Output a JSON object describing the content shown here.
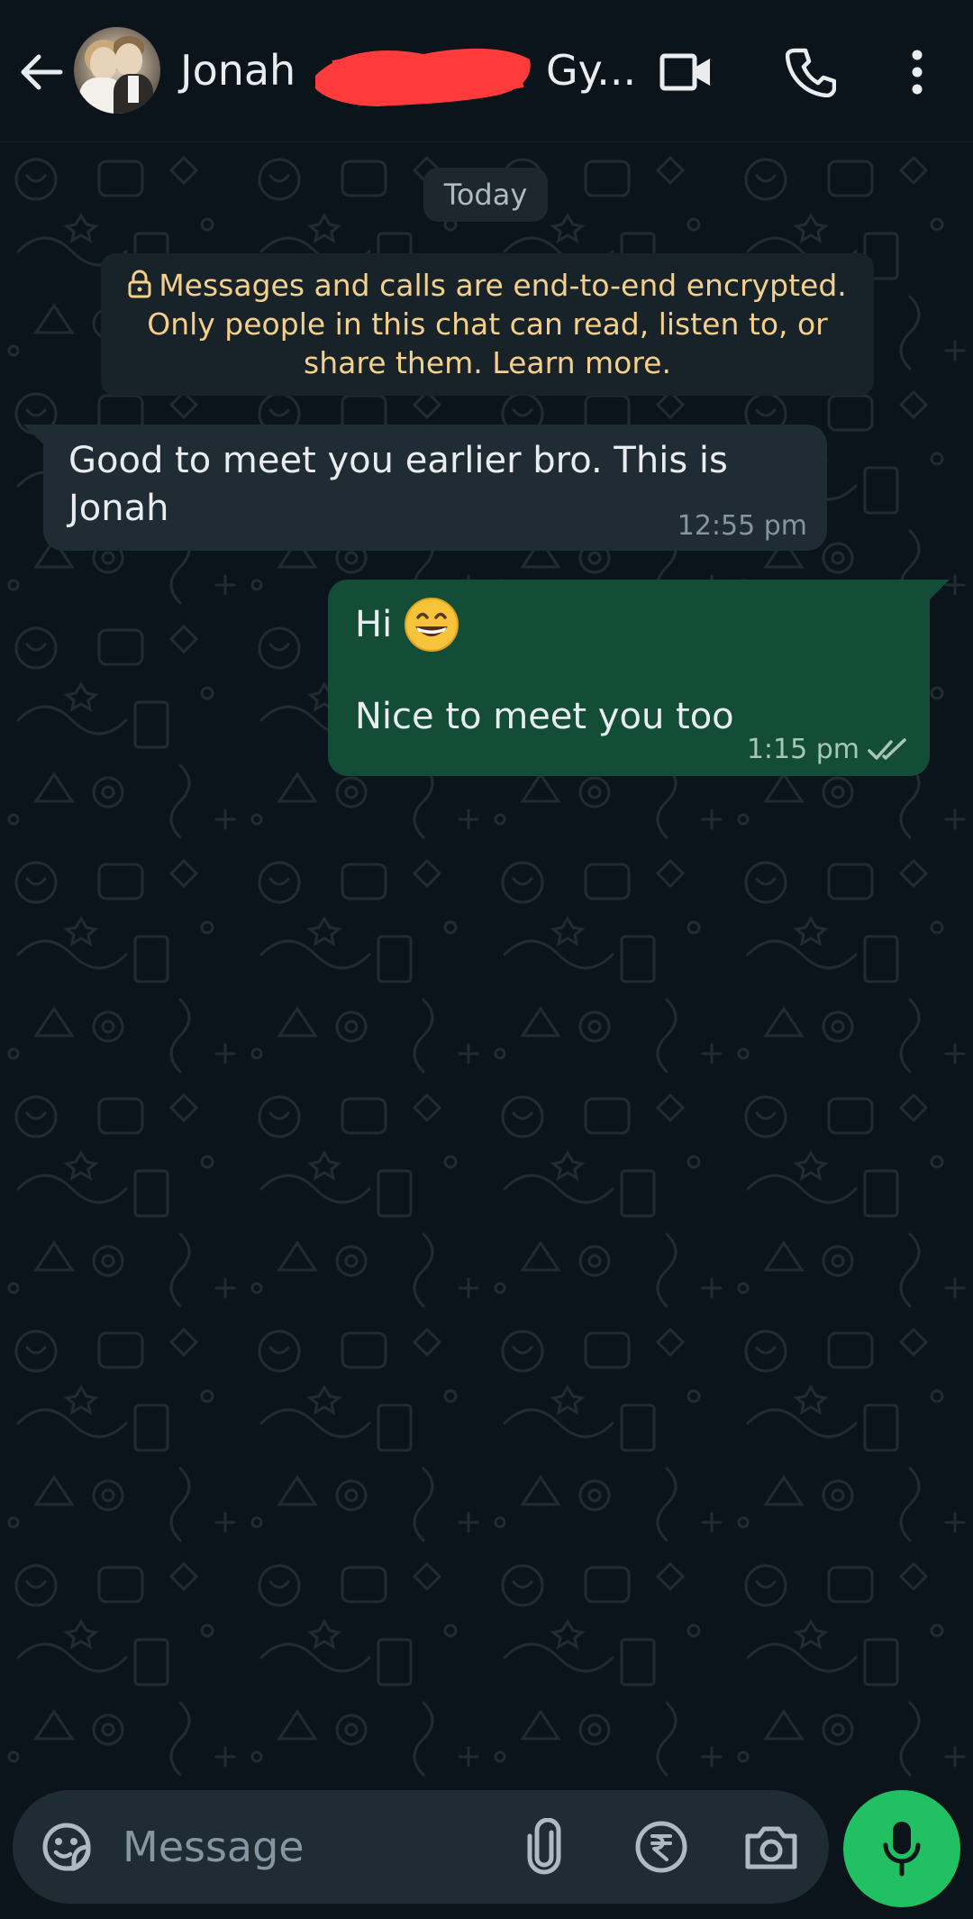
{
  "header": {
    "contact_name_prefix": "Jonah",
    "contact_name_suffix": "Gy...",
    "icons": [
      "back-arrow-icon",
      "video-call-icon",
      "voice-call-icon",
      "more-options-icon"
    ]
  },
  "chat": {
    "date_chip": "Today",
    "encryption_notice": "Messages and calls are end-to-end encrypted. Only people in this chat can read, listen to, or share them. Learn more.",
    "messages": [
      {
        "direction": "incoming",
        "text": "Good to meet you earlier bro. This is Jonah",
        "time": "12:55 pm"
      },
      {
        "direction": "outgoing",
        "line1": "Hi",
        "emoji": "grinning-face-with-smiling-eyes",
        "line2": "Nice to meet you too",
        "time": "1:15 pm",
        "status": "delivered-double-tick"
      }
    ]
  },
  "composer": {
    "placeholder": "Message",
    "icons": [
      "sticker-icon",
      "paperclip-icon",
      "rupee-payment-icon",
      "camera-icon",
      "microphone-icon"
    ]
  },
  "colors": {
    "background": "#0b141a",
    "incoming_bubble": "#1f2c34",
    "outgoing_bubble": "#144d37",
    "encryption_text": "#f5d08a",
    "accent_green": "#21c063",
    "redaction_red": "#ff3b3b"
  }
}
